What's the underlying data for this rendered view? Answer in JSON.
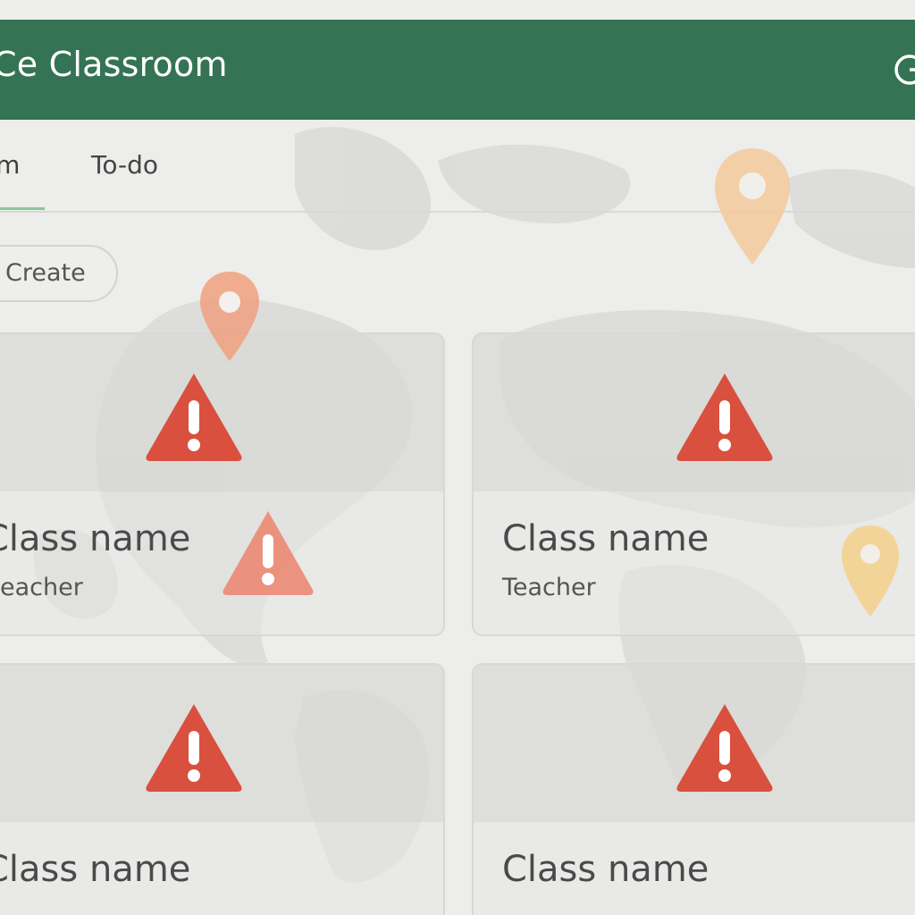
{
  "header": {
    "title": "Ce Classroom",
    "background_color": "#347353",
    "account_icon": "circle-icon"
  },
  "tabs": [
    {
      "label": "am",
      "active": true
    },
    {
      "label": "To-do",
      "active": false
    }
  ],
  "toolbar": {
    "create_label": "Create",
    "create_icon": "plus-icon"
  },
  "cards": [
    {
      "title": "Class name",
      "subtitle": "eacher",
      "icon": "warning-icon"
    },
    {
      "title": "Class name",
      "subtitle": "Teacher",
      "icon": "warning-icon"
    },
    {
      "title": "Class name",
      "subtitle": "",
      "icon": "warning-icon"
    },
    {
      "title": "Class name",
      "subtitle": "",
      "icon": "warning-icon"
    }
  ],
  "overlays": {
    "pins": [
      "location-pin-icon",
      "location-pin-icon",
      "location-pin-icon"
    ],
    "extra_warning": "warning-icon"
  },
  "colors": {
    "warning": "#d9503f",
    "pin_orange": "#f0a07f",
    "pin_peach": "#f3c99c",
    "pin_yellow": "#f4d08a"
  }
}
